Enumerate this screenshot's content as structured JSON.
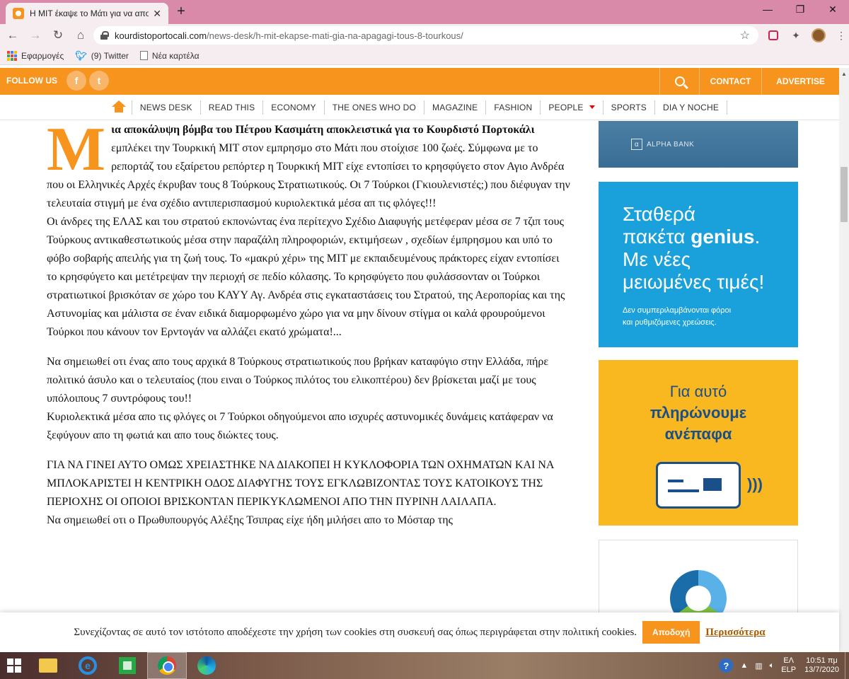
{
  "browser": {
    "tab_title": "Η ΜΙΤ έκαψε το Μάτι για να απο",
    "url_host": "kourdistoportocali.com",
    "url_path": "/news-desk/h-mit-ekapse-mati-gia-na-apagagi-tous-8-tourkous/",
    "bookmarks": [
      "Εφαρμογές",
      "(9) Twitter",
      "Νέα καρτέλα"
    ],
    "icons": [
      "back-icon",
      "forward-icon",
      "reload-icon",
      "home-icon",
      "lock-icon",
      "star-icon",
      "pocket-icon",
      "extensions-icon",
      "profile-icon",
      "menu-icon"
    ]
  },
  "site": {
    "follow_label": "FOLLOW US",
    "social": [
      "f",
      "t"
    ],
    "contact": "CONTACT",
    "advertise": "ADVERTISE",
    "nav": [
      "NEWS DESK",
      "READ THIS",
      "ECONOMY",
      "THE ONES WHO DO",
      "MAGAZINE",
      "FASHION",
      "PEOPLE",
      "SPORTS",
      "DIA Y NOCHE"
    ],
    "accent": "#f7941d"
  },
  "article": {
    "dropcap": "Μ",
    "p1_bold": "ια αποκάλυψη βόμβα του Πέτρου Κασιμάτη αποκλειστικά για το Κουρδιστό Πορτοκάλι",
    "p1_rest": " εμπλέκει την Τουρκική ΜΙΤ στον εμπρησμο στο Μάτι που στοίχισε 100 ζωές. Σύμφωνα με το ρεπορτάζ του εξαίρετου ρεπόρτερ η Τουρκική ΜΙΤ είχε εντοπίσει το κρησφύγετο στον Αγιο Ανδρέα που οι Ελληνικές Αρχές έκρυβαν τους 8 Τούρκους Στρατιωτικούς. Οι 7 Τούρκοι (Γκιουλενιστές;) που διέφυγαν την τελευταία στιγμή με ένα σχέδιο αντιπερισπασμού κυριολεκτικά μέσα απ τις φλόγες!!!",
    "p2": "Οι άνδρες της ΕΛΑΣ και του στρατού εκπονώντας ένα περίτεχνο Σχέδιο Διαφυγής μετέφεραν μέσα σε 7 τζιπ τους Τούρκους αντικαθεστωτικούς μέσα στην παραζάλη πληροφοριών, εκτιμήσεων , σχεδίων έμπρησμου και υπό το φόβο σοβαρής απειλής για τη ζωή τους. Το «μακρύ χέρι» της ΜΙΤ με εκπαιδευμένους πράκτορες είχαν εντοπίσει το κρησφύγετο και μετέτρεψαν την περιοχή σε πεδίο κόλασης. Το κρησφύγετο που φυλάσσονταν οι Τούρκοι στρατιωτικοί βρισκόταν σε χώρο του ΚΑΥΥ Αγ. Ανδρέα στις εγκαταστάσεις του Στρατού, της Αεροπορίας και της Αστυνομίας και μάλιστα σε έναν ειδικά διαμορφωμένο χώρο για να μην δίνουν στίγμα οι καλά φρουρούμενοι Τούρκοι που κάνουν τον Ερντογάν να αλλάζει εκατό χρώματα!...",
    "p3a": "Να σημειωθεί οτι ένας απο τους αρχικά 8 Τούρκους στρατιωτικούς που βρήκαν καταφύγιο στην Ελλάδα, πήρε πολιτικό άσυλο και ο τελευταίος (που ειναι ο Τούρκος πιλότος του ελικοπτέρου) δεν βρίσκεται μαζί με τους υπόλοιπους 7 συντρόφους του!!",
    "p3b": "Κυριολεκτικά μέσα απο τις φλόγες οι 7 Τούρκοι οδηγούμενοι απο ισχυρές αστυνομικές δυνάμεις κατάφεραν να ξεφύγουν απο τη φωτιά και απο τους διώκτες τους.",
    "p4a": "ΓΙΑ ΝΑ ΓΙΝΕΙ ΑΥΤΟ ΟΜΩΣ ΧΡΕΙΑΣΤΗΚΕ ΝΑ ΔΙΑΚΟΠΕΙ Η ΚΥΚΛΟΦΟΡΙΑ ΤΩΝ ΟΧΗΜΑΤΩΝ ΚΑΙ ΝΑ ΜΠΛΟΚΑΡΙΣΤΕΙ Η ΚΕΝΤΡΙΚΗ ΟΔΟΣ ΔΙΑΦΥΓΗΣ ΤΟΥΣ ΕΓΚΛΩΒΙΖΟΝΤΑΣ ΤΟΥΣ ΚΑΤΟΙΚΟΥΣ ΤΗΣ ΠΕΡΙΟΧΗΣ ΟΙ ΟΠΟΙΟΙ ΒΡΙΣΚΟΝΤΑΝ ΠΕΡΙΚΥΚΛΩΜΕΝΟΙ ΑΠΟ ΤΗΝ ΠΥΡΙΝΗ ΛΑΙΛΑΠΑ.",
    "p4b": "Να σημειωθεί οτι ο Πρωθυπουργός Αλέξης Τσιπρας είχε ήδη μιλήσει απο το Μόσταρ της"
  },
  "ads": {
    "alpha": "ALPHA BANK",
    "genius_l1": "Σταθερά",
    "genius_l2a": "πακέτα ",
    "genius_l2b": "genius",
    "genius_l3": "Με νέες",
    "genius_l4": "μειωμένες τιμές!",
    "genius_small1": "Δεν συμπεριλαμβάνονται φόροι",
    "genius_small2": "και ρυθμιζόμενες χρεώσεις.",
    "pay_l1": "Για αυτό",
    "pay_l2": "πληρώνουμε",
    "pay_l3": "ανέπαφα"
  },
  "cookie": {
    "text": "Συνεχίζοντας σε αυτό τον ιστότοπο αποδέχεστε την χρήση των cookies στη συσκευή σας όπως περιγράφεται στην πολιτική cookies.",
    "accept": "Αποδοχή",
    "more": "Περισσότερα"
  },
  "taskbar": {
    "lang1": "ΕΛ",
    "lang2": "ELP",
    "time": "10:51 πμ",
    "date": "13/7/2020"
  }
}
